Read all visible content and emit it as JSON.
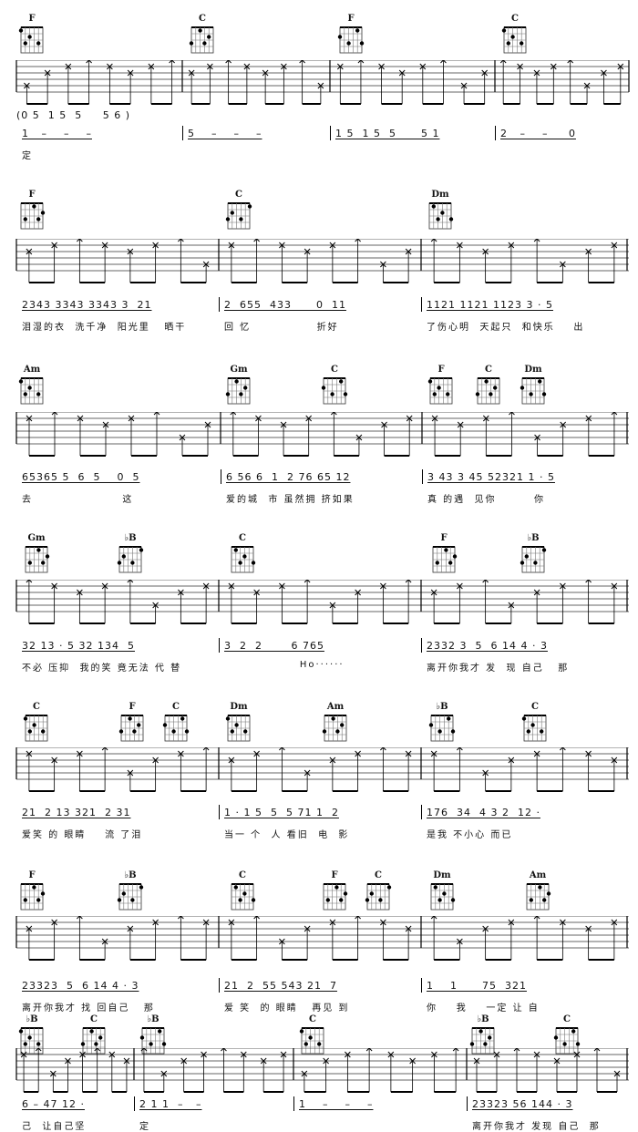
{
  "score": {
    "intro_notation": "(0 5  1 5  5     5 6 )",
    "systems": [
      {
        "chords": [
          "F",
          "C",
          "F",
          "C"
        ],
        "measures": [
          {
            "notation": "1   –    –    –",
            "lyrics": "定"
          },
          {
            "notation": "5    –    –    –",
            "lyrics": ""
          },
          {
            "notation": "1 5  1 5  5      5 1",
            "lyrics": ""
          },
          {
            "notation": "2   –    –     0",
            "lyrics": ""
          }
        ]
      },
      {
        "chords": [
          "F",
          "C",
          "Dm"
        ],
        "measures": [
          {
            "notation": "2343 3343 3343 3  21",
            "lyrics": "泪湿的衣  洗千净  阳光里   晒干"
          },
          {
            "notation": "2  655  433      0  11",
            "lyrics": "回 忆              折好"
          },
          {
            "notation": "1121 1121 1123 3 · 5",
            "lyrics": "了伤心明  天起只  和快乐    出"
          }
        ]
      },
      {
        "chords": [
          "Am",
          "Gm",
          "C",
          "F",
          "C",
          "Dm"
        ],
        "measures": [
          {
            "notation": "65365 5  6  5    0  5",
            "lyrics": "去                   这"
          },
          {
            "notation": "6 56 6  1  2 76 65 12",
            "lyrics": "爱的城  市 虽然拥 挤如果"
          },
          {
            "notation": "3 43 3 45 52321 1 · 5",
            "lyrics": "真 的遇  见你        你"
          }
        ]
      },
      {
        "chords": [
          "Gm",
          "♭B",
          "C",
          "F",
          "♭B"
        ],
        "measures": [
          {
            "notation": "32 13 · 5 32 134  5",
            "lyrics": "不必 压抑  我的笑 竟无法 代 替"
          },
          {
            "notation": "3  2  2       6 765",
            "lyrics": "                Ho······"
          },
          {
            "notation": "2332 3  5  6 14 4 · 3",
            "lyrics": "离开你我才 发  现 自己   那"
          }
        ]
      },
      {
        "chords": [
          "C",
          "F",
          "C",
          "Dm",
          "Am",
          "♭B",
          "C"
        ],
        "measures": [
          {
            "notation": "21  2 13 321  2 31",
            "lyrics": "爱笑 的 眼睛    流 了泪"
          },
          {
            "notation": "1 · 1 5  5  5 71 1  2",
            "lyrics": "当一 个  人 看旧  电  影"
          },
          {
            "notation": "176  34  4 3 2  12 ·",
            "lyrics": "是我 不小心 而已"
          }
        ]
      },
      {
        "chords": [
          "F",
          "♭B",
          "C",
          "F",
          "C",
          "Dm",
          "Am"
        ],
        "measures": [
          {
            "notation": "23323  5  6 14 4 · 3",
            "lyrics": "离开你我才 找 回自己   那"
          },
          {
            "notation": "21  2  55 543 21  7",
            "lyrics": "爱 笑  的 眼睛   再见 到"
          },
          {
            "notation": "1    1      75  321",
            "lyrics": "你    我    一定 让 自"
          }
        ]
      },
      {
        "chords": [
          "♭B",
          "C",
          "♭B",
          "C",
          "♭B",
          "C"
        ],
        "measures": [
          {
            "notation": "6 – 47 12 ·",
            "lyrics": "己  让自己坚"
          },
          {
            "notation": "2 1 1  –   –",
            "lyrics": "定"
          },
          {
            "notation": "1    –    –    –",
            "lyrics": ""
          },
          {
            "notation": "23323 56 144 · 3",
            "lyrics": "离开你我才 发现 自己  那"
          }
        ]
      }
    ]
  }
}
